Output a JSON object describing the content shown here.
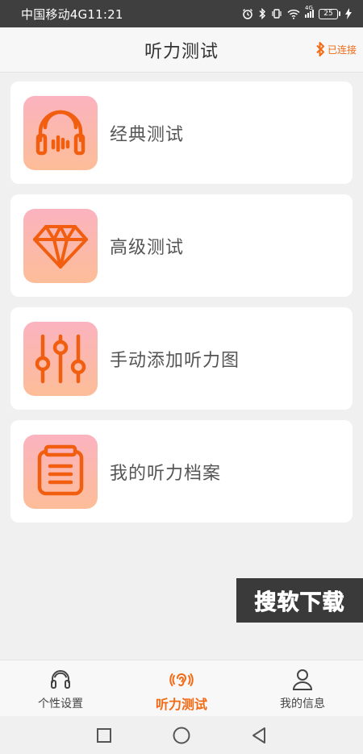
{
  "status_bar": {
    "carrier_time": "中国移动4G11:21",
    "signal_badge": "4G",
    "battery": "25"
  },
  "header": {
    "title": "听力测试",
    "bt_status": "已连接"
  },
  "cards": [
    {
      "label": "经典测试",
      "icon": "headphones-icon"
    },
    {
      "label": "高级测试",
      "icon": "diamond-icon"
    },
    {
      "label": "手动添加听力图",
      "icon": "sliders-icon"
    },
    {
      "label": "我的听力档案",
      "icon": "document-icon"
    }
  ],
  "watermark": "搜软下载",
  "bottom_nav": {
    "items": [
      {
        "label": "个性设置",
        "icon": "headset-icon",
        "active": false
      },
      {
        "label": "听力测试",
        "icon": "ear-icon",
        "active": true
      },
      {
        "label": "我的信息",
        "icon": "person-icon",
        "active": false
      }
    ]
  },
  "colors": {
    "accent": "#f26a14",
    "icon_gradient_top": "#fbb3bf",
    "icon_gradient_bottom": "#fdbd98"
  }
}
